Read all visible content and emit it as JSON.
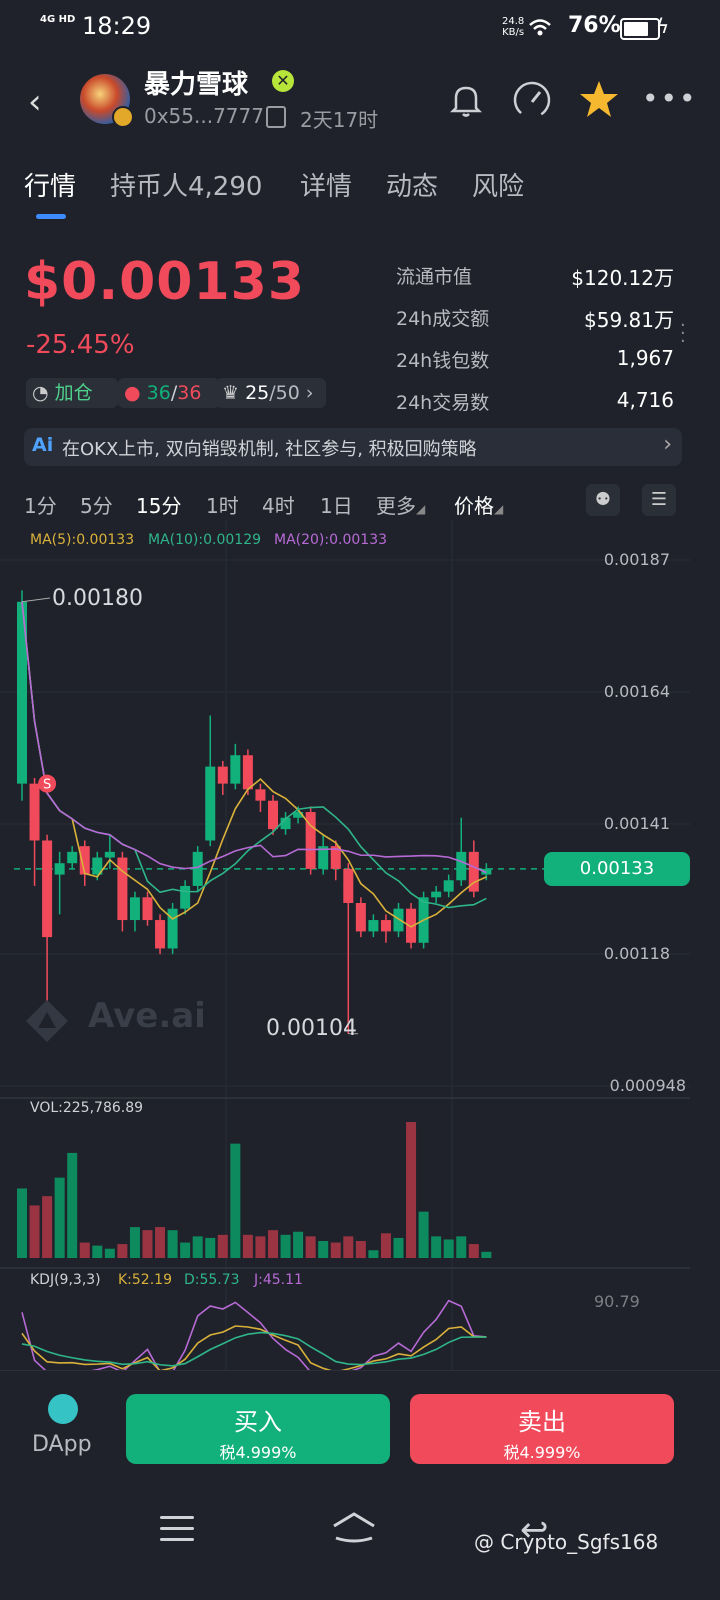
{
  "status_bar": {
    "network": "4G HD",
    "time": "18:29",
    "net_speed_value": "24.8",
    "net_speed_unit": "KB/s",
    "battery_pct": "76%",
    "battery_level": 0.76
  },
  "header": {
    "token_name": "暴力雪球",
    "address": "0x55...7777",
    "age": "2天17时",
    "icons": [
      "back-icon",
      "bell-icon",
      "gauge-icon",
      "star-icon",
      "more-icon"
    ]
  },
  "tabs": [
    {
      "label": "行情",
      "active": true
    },
    {
      "label": "持币人4,290",
      "active": false
    },
    {
      "label": "详情",
      "active": false
    },
    {
      "label": "动态",
      "active": false
    },
    {
      "label": "风险",
      "active": false
    }
  ],
  "price": {
    "value": "$0.00133",
    "change": "-25.45%",
    "chips": {
      "add_position": "加仓",
      "bag_green": "36",
      "bag_red": "36",
      "crown_a": "25",
      "crown_b": "/50"
    }
  },
  "stats": [
    {
      "label": "流通市值",
      "value": "$120.12万"
    },
    {
      "label": "24h成交额",
      "value": "$59.81万"
    },
    {
      "label": "24h钱包数",
      "value": "1,967"
    },
    {
      "label": "24h交易数",
      "value": "4,716"
    }
  ],
  "banner": {
    "ai_label": "Ai",
    "text": "在OKX上市, 双向销毁机制, 社区参与, 积极回购策略"
  },
  "timeframes": [
    {
      "label": "1分",
      "active": false
    },
    {
      "label": "5分",
      "active": false
    },
    {
      "label": "15分",
      "active": true
    },
    {
      "label": "1时",
      "active": false
    },
    {
      "label": "4时",
      "active": false
    },
    {
      "label": "1日",
      "active": false
    },
    {
      "label": "更多",
      "active": false
    },
    {
      "label": "价格",
      "active": false
    }
  ],
  "chart_data": {
    "type": "candlestick",
    "ma_legend": [
      {
        "label": "MA(5):0.00133",
        "color": "#d9b13b"
      },
      {
        "label": "MA(10):0.00129",
        "color": "#2fb58a"
      },
      {
        "label": "MA(20):0.00133",
        "color": "#b76ad6"
      }
    ],
    "y_ticks": [
      "0.00187",
      "0.00164",
      "0.00141",
      "0.00118",
      "0.000948"
    ],
    "current_price_tag": "0.00133",
    "high_marker": "0.00180",
    "low_marker": "0.00104",
    "sell_marker": "S",
    "ylim": [
      0.000948,
      0.00187
    ],
    "candles": [
      {
        "o": 0.00148,
        "c": 0.0018,
        "h": 0.00182,
        "l": 0.00145
      },
      {
        "o": 0.00148,
        "c": 0.00138,
        "h": 0.00149,
        "l": 0.0013
      },
      {
        "o": 0.00138,
        "c": 0.00121,
        "h": 0.00139,
        "l": 0.00108
      },
      {
        "o": 0.00132,
        "c": 0.00134,
        "h": 0.00136,
        "l": 0.00125
      },
      {
        "o": 0.00134,
        "c": 0.00136,
        "h": 0.00137,
        "l": 0.00133
      },
      {
        "o": 0.00137,
        "c": 0.00132,
        "h": 0.00138,
        "l": 0.0013
      },
      {
        "o": 0.00132,
        "c": 0.00135,
        "h": 0.00136,
        "l": 0.00131
      },
      {
        "o": 0.00135,
        "c": 0.00136,
        "h": 0.00139,
        "l": 0.00133
      },
      {
        "o": 0.00135,
        "c": 0.00124,
        "h": 0.00136,
        "l": 0.00122
      },
      {
        "o": 0.00124,
        "c": 0.00128,
        "h": 0.00129,
        "l": 0.00122
      },
      {
        "o": 0.00128,
        "c": 0.00124,
        "h": 0.00129,
        "l": 0.00123
      },
      {
        "o": 0.00124,
        "c": 0.00119,
        "h": 0.00125,
        "l": 0.00118
      },
      {
        "o": 0.00119,
        "c": 0.00126,
        "h": 0.00127,
        "l": 0.00118
      },
      {
        "o": 0.00126,
        "c": 0.0013,
        "h": 0.00131,
        "l": 0.00125
      },
      {
        "o": 0.0013,
        "c": 0.00136,
        "h": 0.00137,
        "l": 0.00129
      },
      {
        "o": 0.00138,
        "c": 0.00151,
        "h": 0.0016,
        "l": 0.00137
      },
      {
        "o": 0.00151,
        "c": 0.00148,
        "h": 0.00152,
        "l": 0.00146
      },
      {
        "o": 0.00148,
        "c": 0.00153,
        "h": 0.00155,
        "l": 0.00147
      },
      {
        "o": 0.00153,
        "c": 0.00147,
        "h": 0.00154,
        "l": 0.00146
      },
      {
        "o": 0.00147,
        "c": 0.00145,
        "h": 0.00148,
        "l": 0.00143
      },
      {
        "o": 0.00145,
        "c": 0.0014,
        "h": 0.00146,
        "l": 0.00139
      },
      {
        "o": 0.0014,
        "c": 0.00142,
        "h": 0.00143,
        "l": 0.00139
      },
      {
        "o": 0.00142,
        "c": 0.00143,
        "h": 0.00144,
        "l": 0.00141
      },
      {
        "o": 0.00143,
        "c": 0.00133,
        "h": 0.00144,
        "l": 0.00132
      },
      {
        "o": 0.00133,
        "c": 0.00137,
        "h": 0.00139,
        "l": 0.00132
      },
      {
        "o": 0.00137,
        "c": 0.00133,
        "h": 0.00138,
        "l": 0.00131
      },
      {
        "o": 0.00133,
        "c": 0.00127,
        "h": 0.00134,
        "l": 0.00104
      },
      {
        "o": 0.00127,
        "c": 0.00122,
        "h": 0.00128,
        "l": 0.00121
      },
      {
        "o": 0.00122,
        "c": 0.00124,
        "h": 0.00125,
        "l": 0.00121
      },
      {
        "o": 0.00124,
        "c": 0.00122,
        "h": 0.00125,
        "l": 0.0012
      },
      {
        "o": 0.00122,
        "c": 0.00126,
        "h": 0.00127,
        "l": 0.00121
      },
      {
        "o": 0.00126,
        "c": 0.0012,
        "h": 0.00127,
        "l": 0.00119
      },
      {
        "o": 0.0012,
        "c": 0.00128,
        "h": 0.00129,
        "l": 0.00119
      },
      {
        "o": 0.00128,
        "c": 0.00129,
        "h": 0.0013,
        "l": 0.00127
      },
      {
        "o": 0.00129,
        "c": 0.00131,
        "h": 0.00132,
        "l": 0.00128
      },
      {
        "o": 0.00131,
        "c": 0.00136,
        "h": 0.00142,
        "l": 0.0013
      },
      {
        "o": 0.00136,
        "c": 0.00129,
        "h": 0.00138,
        "l": 0.00128
      },
      {
        "o": 0.00132,
        "c": 0.00133,
        "h": 0.00134,
        "l": 0.00131
      }
    ],
    "volume_label": "VOL:225,786.89",
    "volumes": [
      45,
      34,
      40,
      52,
      68,
      10,
      8,
      6,
      9,
      20,
      18,
      20,
      18,
      10,
      14,
      13,
      15,
      74,
      15,
      14,
      18,
      15,
      17,
      14,
      11,
      10,
      14,
      11,
      5,
      16,
      13,
      88,
      30,
      14,
      12,
      14,
      9,
      4
    ],
    "kdj_legend": [
      {
        "label": "KDJ(9,3,3)",
        "color": "#d0d2d8"
      },
      {
        "label": "K:52.19",
        "color": "#d9b13b"
      },
      {
        "label": "D:55.73",
        "color": "#2fb58a"
      },
      {
        "label": "J:45.11",
        "color": "#b76ad6"
      }
    ],
    "kdj_top_tick": "90.79"
  },
  "watermark": "Ave.ai",
  "actions": {
    "dapp_label": "DApp",
    "buy_label": "买入",
    "buy_tax": "税4.999%",
    "sell_label": "卖出",
    "sell_tax": "税4.999%"
  },
  "credit": "@ Crypto_Sgfs168",
  "colors": {
    "up": "#12b07a",
    "down": "#f04a5b",
    "accent": "#3c8cff"
  }
}
